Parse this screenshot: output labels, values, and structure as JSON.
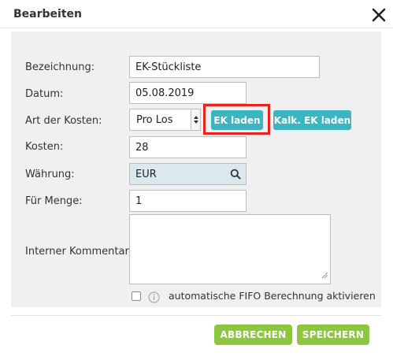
{
  "dialog": {
    "title": "Bearbeiten",
    "close_icon": "close-icon"
  },
  "form": {
    "bezeichnung": {
      "label": "Bezeichnung:",
      "value": "EK-Stückliste"
    },
    "datum": {
      "label": "Datum:",
      "value": "05.08.2019"
    },
    "art_der_kosten": {
      "label": "Art der Kosten:",
      "selected": "Pro Los",
      "ek_laden_label": "EK laden",
      "kalk_ek_laden_label": "Kalk. EK laden"
    },
    "kosten": {
      "label": "Kosten:",
      "value": "28"
    },
    "waehrung": {
      "label": "Währung:",
      "value": "EUR",
      "icon": "search-icon"
    },
    "fuer_menge": {
      "label": "Für Menge:",
      "value": "1"
    },
    "interner_kommentar": {
      "label": "Interner Kommentar:",
      "value": ""
    },
    "fifo": {
      "checked": false,
      "info_icon": "info-icon",
      "label": "automatische FIFO Berechnung aktivieren"
    }
  },
  "footer": {
    "cancel_label": "ABBRECHEN",
    "save_label": "SPEICHERN"
  },
  "colors": {
    "teal_button": "#3ab5c1",
    "green_button": "#8dc63f",
    "highlight": "#e8231c",
    "readonly_field": "#dbe9ef"
  }
}
